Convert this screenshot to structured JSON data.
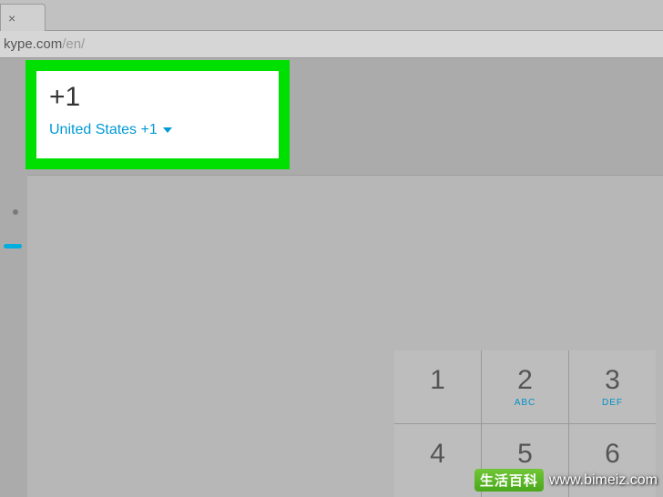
{
  "browser": {
    "url_main": "kype.com",
    "url_path": "/en/",
    "close_glyph": "×"
  },
  "dialer": {
    "number_value": "+1",
    "country_label": "United States  +1"
  },
  "keypad": {
    "rows": [
      [
        {
          "digit": "1",
          "letters": ""
        },
        {
          "digit": "2",
          "letters": "ABC"
        },
        {
          "digit": "3",
          "letters": "DEF"
        }
      ],
      [
        {
          "digit": "4",
          "letters": ""
        },
        {
          "digit": "5",
          "letters": ""
        },
        {
          "digit": "6",
          "letters": ""
        }
      ]
    ]
  },
  "watermark": {
    "logo_text": "生活百科",
    "url_text": "www.bimeiz.com"
  },
  "colors": {
    "highlight": "#00e000",
    "skype_accent": "#0099d6"
  }
}
